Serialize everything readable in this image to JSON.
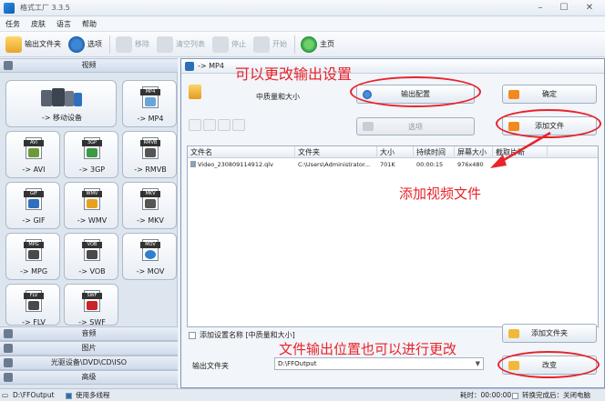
{
  "window": {
    "title": "格式工厂 3.3.5",
    "controls": [
      "–",
      "☐",
      "✕"
    ]
  },
  "menu": [
    "任务",
    "皮肤",
    "语言",
    "帮助"
  ],
  "toolbar": {
    "output_folder": "输出文件夹",
    "options": "选项",
    "remove": "移除",
    "clear_list": "清空列表",
    "stop": "停止",
    "start": "开始",
    "home": "主页"
  },
  "left_panel": {
    "categories": {
      "video": "视频",
      "audio": "音频",
      "picture": "图片",
      "rom": "光驱设备\\DVD\\CD\\ISO",
      "advanced": "高级"
    },
    "formats": [
      {
        "tag": "MP4",
        "label": "-> MP4"
      },
      {
        "tag": "AVI",
        "label": "-> AVI"
      },
      {
        "tag": "3GP",
        "label": "-> 3GP"
      },
      {
        "tag": "RMVB",
        "label": "-> RMVB"
      },
      {
        "tag": "GIF",
        "label": "-> GIF"
      },
      {
        "tag": "WMV",
        "label": "-> WMV"
      },
      {
        "tag": "MKV",
        "label": "-> MKV"
      },
      {
        "tag": "MPG",
        "label": "-> MPG"
      },
      {
        "tag": "VOB",
        "label": "-> VOB"
      },
      {
        "tag": "MOV",
        "label": "-> MOV"
      },
      {
        "tag": "FLV",
        "label": "-> FLV"
      },
      {
        "tag": "SWF",
        "label": "-> SWF"
      }
    ],
    "mobile": "-> 移动设备"
  },
  "dialog": {
    "title": "-> MP4",
    "quality": "中质量和大小",
    "output_config": "输出配置",
    "ok": "确定",
    "options": "选项",
    "add_file": "添加文件",
    "columns": [
      "文件名",
      "文件夹",
      "大小",
      "持续时间",
      "屏幕大小",
      "截取片断"
    ],
    "rows": [
      {
        "name": "Video_230809114912.qlv",
        "folder": "C:\\Users\\Administrator...",
        "size": "701K",
        "duration": "00:00:15",
        "screen": "976x480",
        "clip": ""
      }
    ],
    "add_setting_name": "添加设置名称 [中质量和大小]",
    "add_folder": "添加文件夹",
    "output_folder_label": "输出文件夹",
    "output_folder_value": "D:\\FFOutput",
    "change": "改变"
  },
  "annotations": {
    "top": "可以更改输出设置",
    "middle": "添加视频文件",
    "bottom": "文件输出位置也可以进行更改"
  },
  "statusbar": {
    "output_path": "D:\\FFOutput",
    "multithread": "使用多线程",
    "elapsed": "耗时：00:00:00",
    "after_done": "转换完成后：关闭电脑"
  }
}
